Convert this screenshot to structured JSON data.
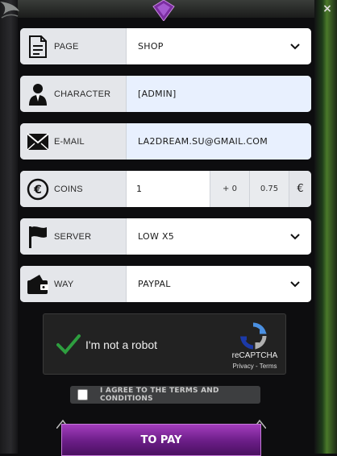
{
  "form": {
    "page": {
      "label": "PAGE",
      "value": "SHOP",
      "icon": "document-icon"
    },
    "character": {
      "label": "CHARACTER",
      "value": "[ADMIN]",
      "icon": "user-icon"
    },
    "email": {
      "label": "E-MAIL",
      "value": "LA2DREAM.SU@GMAIL.COM",
      "icon": "envelope-icon"
    },
    "coins": {
      "label": "COINS",
      "value": "1",
      "bonus": "+ 0",
      "rate": "0.75",
      "currency": "€",
      "icon": "coin-icon"
    },
    "server": {
      "label": "SERVER",
      "value": "LOW X5",
      "icon": "flag-icon"
    },
    "way": {
      "label": "WAY",
      "value": "PAYPAL",
      "icon": "wallet-icon"
    }
  },
  "captcha": {
    "text": "I'm not a robot",
    "brand": "reCAPTCHA",
    "links": "Privacy - Terms"
  },
  "agree": {
    "text": "I AGREE TO THE TERMS AND CONDITIONS"
  },
  "pay_button": {
    "label": "TO PAY"
  },
  "close": {
    "label": "×"
  },
  "colors": {
    "accent": "#7a2596",
    "check": "#2e9e3f",
    "field_bg": "#e4e6ea",
    "autofill_bg": "#e8f0fe"
  }
}
